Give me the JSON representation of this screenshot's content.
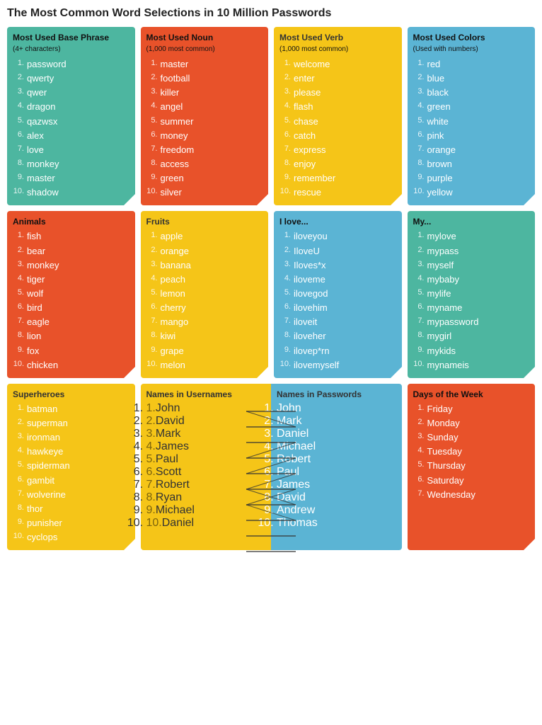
{
  "title": "The Most Common Word Selections in 10 Million Passwords",
  "sections": [
    {
      "id": "base-phrase",
      "title": "Most Used Base Phrase",
      "subtitle": "(4+ characters)",
      "color": "green",
      "items": [
        "password",
        "qwerty",
        "qwer",
        "dragon",
        "qazwsx",
        "alex",
        "love",
        "monkey",
        "master",
        "shadow"
      ]
    },
    {
      "id": "nouns",
      "title": "Most Used Noun",
      "subtitle": "(1,000 most common)",
      "color": "orange-red",
      "items": [
        "master",
        "football",
        "killer",
        "angel",
        "summer",
        "money",
        "freedom",
        "access",
        "green",
        "silver"
      ]
    },
    {
      "id": "verbs",
      "title": "Most Used Verb",
      "subtitle": "(1,000 most common)",
      "color": "yellow",
      "items": [
        "welcome",
        "enter",
        "please",
        "flash",
        "chase",
        "catch",
        "express",
        "enjoy",
        "remember",
        "rescue"
      ]
    },
    {
      "id": "colors",
      "title": "Most Used Colors",
      "subtitle": "(Used with numbers)",
      "color": "blue",
      "items": [
        "red",
        "blue",
        "black",
        "green",
        "white",
        "pink",
        "orange",
        "brown",
        "purple",
        "yellow"
      ]
    },
    {
      "id": "animals",
      "title": "Animals",
      "subtitle": "",
      "color": "orange-red",
      "items": [
        "fish",
        "bear",
        "monkey",
        "tiger",
        "wolf",
        "bird",
        "eagle",
        "lion",
        "fox",
        "chicken"
      ]
    },
    {
      "id": "fruits",
      "title": "Fruits",
      "subtitle": "",
      "color": "yellow",
      "items": [
        "apple",
        "orange",
        "banana",
        "peach",
        "lemon",
        "cherry",
        "mango",
        "kiwi",
        "grape",
        "melon"
      ]
    },
    {
      "id": "ilove",
      "title": "I love...",
      "subtitle": "",
      "color": "blue",
      "items": [
        "iloveyou",
        "IloveU",
        "Iloves*x",
        "iloveme",
        "ilovegod",
        "ilovehim",
        "iloveit",
        "iloveher",
        "ilovep*rn",
        "ilovemyself"
      ]
    },
    {
      "id": "my",
      "title": "My...",
      "subtitle": "",
      "color": "green",
      "items": [
        "mylove",
        "mypass",
        "myself",
        "mybaby",
        "mylife",
        "myname",
        "mypassword",
        "mygirl",
        "mykids",
        "mynameis"
      ]
    },
    {
      "id": "superheroes",
      "title": "Superheroes",
      "subtitle": "",
      "color": "yellow",
      "items": [
        "batman",
        "superman",
        "ironman",
        "hawkeye",
        "spiderman",
        "gambit",
        "wolverine",
        "thor",
        "punisher",
        "cyclops"
      ]
    },
    {
      "id": "days",
      "title": "Days of the Week",
      "subtitle": "",
      "color": "orange-red",
      "items": [
        "Friday",
        "Monday",
        "Sunday",
        "Tuesday",
        "Thursday",
        "Saturday",
        "Wednesday"
      ]
    }
  ],
  "names_usernames": {
    "title": "Names in Usernames",
    "items": [
      "John",
      "David",
      "Mark",
      "James",
      "Paul",
      "Scott",
      "Robert",
      "Ryan",
      "Michael",
      "Daniel"
    ]
  },
  "names_passwords": {
    "title": "Names in Passwords",
    "items": [
      "John",
      "Mark",
      "Daniel",
      "Michael",
      "Robert",
      "Paul",
      "James",
      "David",
      "Andrew",
      "Thomas"
    ]
  },
  "connector_lines": [
    [
      0,
      0
    ],
    [
      1,
      1
    ],
    [
      2,
      3
    ],
    [
      3,
      4
    ],
    [
      4,
      5
    ],
    [
      5,
      2
    ],
    [
      6,
      6
    ],
    [
      7,
      7
    ],
    [
      8,
      8
    ],
    [
      9,
      9
    ]
  ]
}
